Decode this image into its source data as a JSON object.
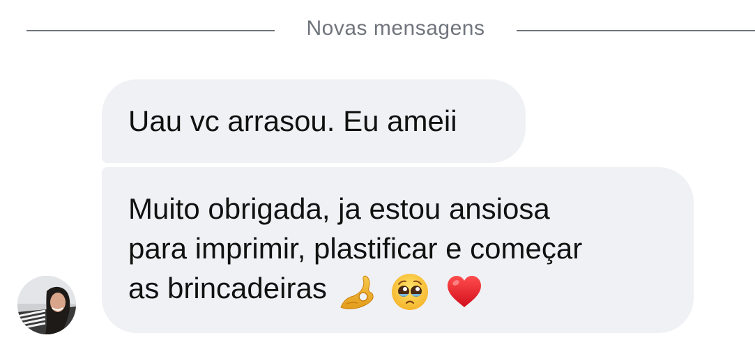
{
  "divider": {
    "label": "Novas mensagens"
  },
  "messages": [
    {
      "text": "Uau vc arrasou. Eu ameii"
    },
    {
      "lines": [
        "Muito obrigada, ja estou ansiosa",
        "para imprimir, plastificar e começar",
        "as brincadeiras"
      ],
      "emojis": [
        "ok-hand-icon",
        "pleading-face-icon",
        "red-heart-icon"
      ]
    }
  ],
  "colors": {
    "bubble": "#f0f1f4",
    "divider": "#6f737b",
    "text": "#111111"
  }
}
